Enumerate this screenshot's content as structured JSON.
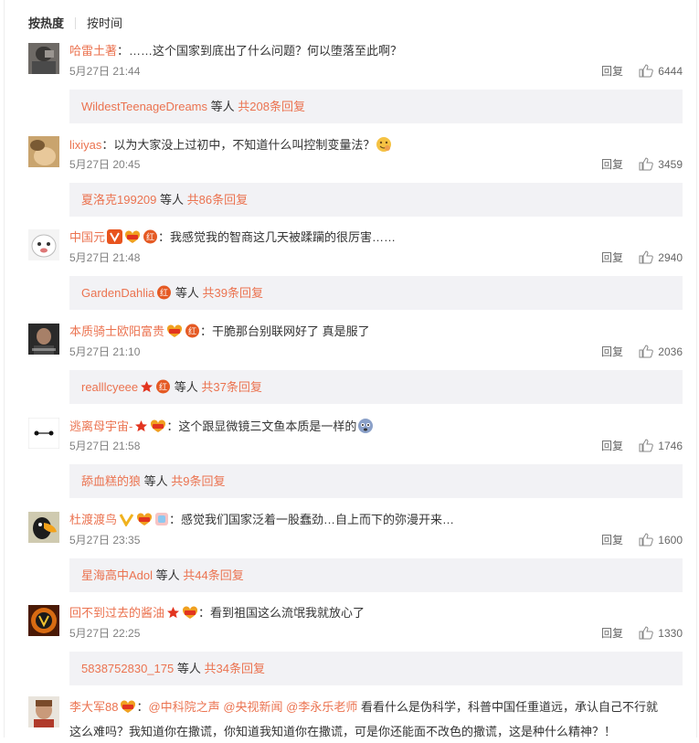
{
  "sort": {
    "hot": "按热度",
    "time": "按时间"
  },
  "ui": {
    "reply_label": "回复",
    "others_suffix": "等人",
    "colon": "："
  },
  "comments": [
    {
      "user": "哈雷土著",
      "text": "……这个国家到底出了什么问题？何以堕落至此啊？",
      "time": "5月27日 21:44",
      "likes": "6444",
      "reply_user": "WildestTeenageDreams",
      "reply_total": "共208条回复"
    },
    {
      "user": "lixiyas",
      "text": "以为大家没上过初中，不知道什么叫控制变量法？",
      "time": "5月27日 20:45",
      "likes": "3459",
      "reply_user": "夏洛克199209",
      "reply_total": "共86条回复"
    },
    {
      "user": "中国元",
      "text": "我感觉我的智商这几天被蹂躏的很厉害……",
      "time": "5月27日 21:48",
      "likes": "2940",
      "reply_user": "GardenDahlia",
      "reply_total": "共39条回复"
    },
    {
      "user": "本质骑士欧阳富贵",
      "text": "干脆那台别联网好了 真是服了",
      "time": "5月27日 21:10",
      "likes": "2036",
      "reply_user": "realllcyeee",
      "reply_total": "共37条回复"
    },
    {
      "user": "逃离母宇宙-",
      "text": "这个跟显微镜三文鱼本质是一样的",
      "time": "5月27日 21:58",
      "likes": "1746",
      "reply_user": "舔血糕的狼",
      "reply_total": "共9条回复"
    },
    {
      "user": "杜渡渡鸟",
      "text": "感觉我们国家泛着一股蠢劲…自上而下的弥漫开来…",
      "time": "5月27日 23:35",
      "likes": "1600",
      "reply_user": "星海高中Adol",
      "reply_total": "共44条回复"
    },
    {
      "user": "回不到过去的酱油",
      "text": "看到祖国这么流氓我就放心了",
      "time": "5月27日 22:25",
      "likes": "1330",
      "reply_user": "5838752830_175",
      "reply_total": "共34条回复"
    }
  ],
  "last_comment": {
    "user": "李大军88",
    "mentions": [
      "@中科院之声",
      "@央视新闻",
      "@李永乐老师"
    ],
    "text_line1": "看看什么是伪科学，科普中国任重道远，承认自己不行就",
    "text_line2": "这么难吗？我知道你在撒谎，你知道我知道你在撒谎，可是你还能面不改色的撒谎，这是种什么精神？！"
  },
  "icons": [
    "thumbs-up-icon",
    "vip-crown-icon",
    "fan-badge-icon",
    "red-heart-badge-icon",
    "star-badge-icon",
    "emoji-icon",
    "reply-icon"
  ],
  "colors": {
    "accent": "#eb7350",
    "reply_bg": "#f2f2f5",
    "gray_text": "#808080"
  }
}
